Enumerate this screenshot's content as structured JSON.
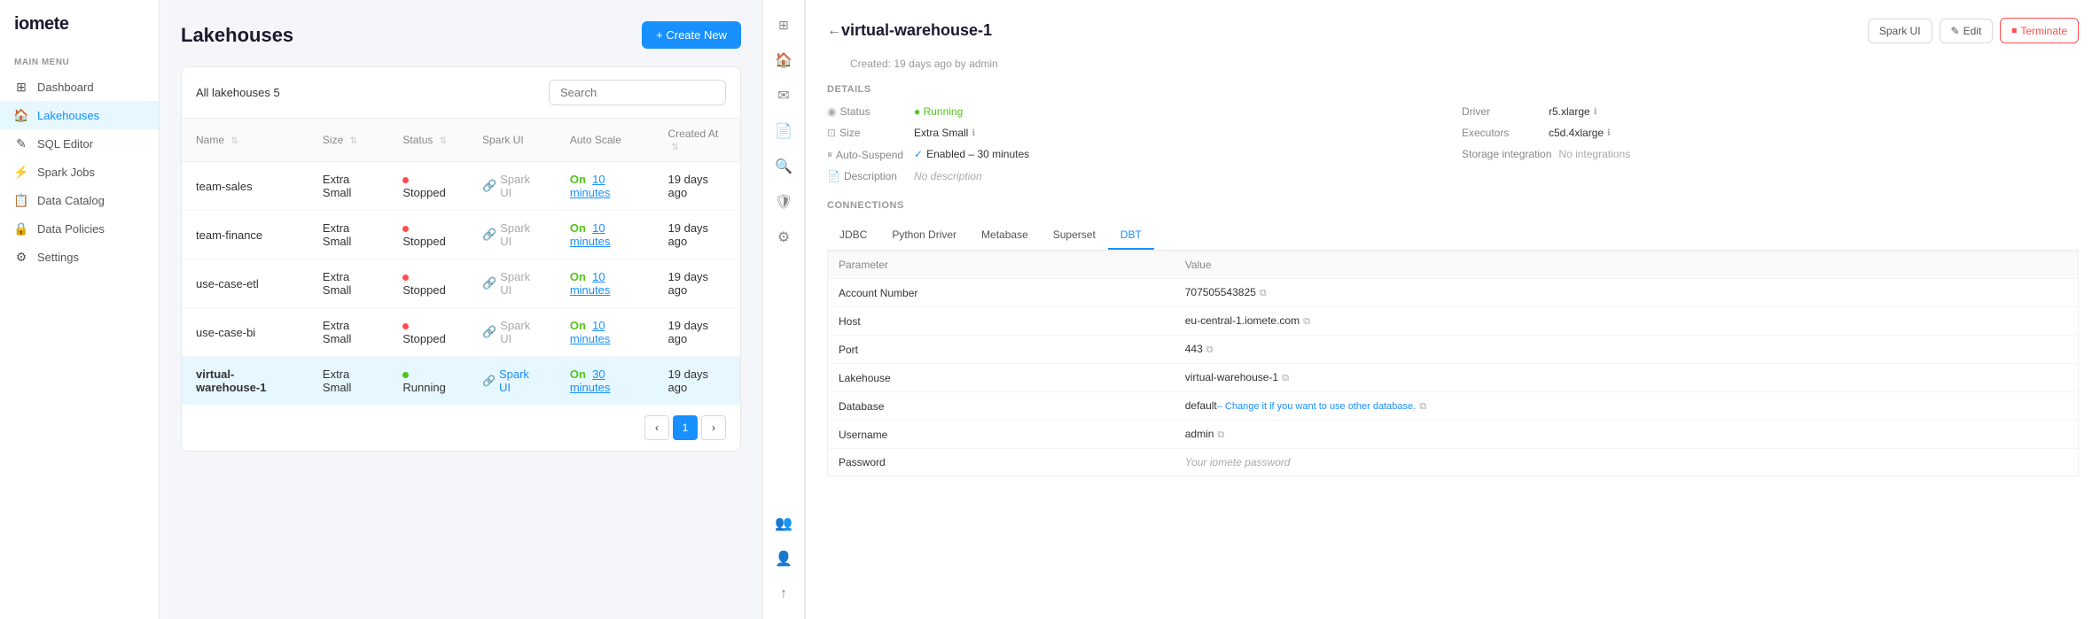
{
  "app": {
    "logo": "iomete",
    "sidebar_toggle_icon": "☰"
  },
  "sidebar": {
    "section_label": "MAIN MENU",
    "items": [
      {
        "id": "dashboard",
        "label": "Dashboard",
        "icon": "⊞",
        "active": false
      },
      {
        "id": "lakehouses",
        "label": "Lakehouses",
        "icon": "🏠",
        "active": true
      },
      {
        "id": "sql-editor",
        "label": "SQL Editor",
        "icon": "✎",
        "active": false
      },
      {
        "id": "spark-jobs",
        "label": "Spark Jobs",
        "icon": "⚡",
        "active": false
      },
      {
        "id": "data-catalog",
        "label": "Data Catalog",
        "icon": "📋",
        "active": false
      },
      {
        "id": "data-policies",
        "label": "Data Policies",
        "icon": "🔒",
        "active": false
      },
      {
        "id": "settings",
        "label": "Settings",
        "icon": "⚙",
        "active": false
      }
    ]
  },
  "lakehouses": {
    "title": "Lakehouses",
    "create_button": "+ Create New",
    "count_label": "All lakehouses",
    "count": "5",
    "search_placeholder": "Search",
    "columns": [
      "Name",
      "Size",
      "Status",
      "Spark UI",
      "Auto Scale",
      "Created At"
    ],
    "rows": [
      {
        "name": "team-sales",
        "size": "Extra Small",
        "status": "Stopped",
        "status_type": "stopped",
        "spark_ui": "Spark UI",
        "spark_ui_enabled": false,
        "autoscale": "On",
        "autoscale_minutes": "10 minutes",
        "created": "19 days ago"
      },
      {
        "name": "team-finance",
        "size": "Extra Small",
        "status": "Stopped",
        "status_type": "stopped",
        "spark_ui": "Spark UI",
        "spark_ui_enabled": false,
        "autoscale": "On",
        "autoscale_minutes": "10 minutes",
        "created": "19 days ago"
      },
      {
        "name": "use-case-etl",
        "size": "Extra Small",
        "status": "Stopped",
        "status_type": "stopped",
        "spark_ui": "Spark UI",
        "spark_ui_enabled": false,
        "autoscale": "On",
        "autoscale_minutes": "10 minutes",
        "created": "19 days ago"
      },
      {
        "name": "use-case-bi",
        "size": "Extra Small",
        "status": "Stopped",
        "status_type": "stopped",
        "spark_ui": "Spark UI",
        "spark_ui_enabled": false,
        "autoscale": "On",
        "autoscale_minutes": "10 minutes",
        "created": "19 days ago"
      },
      {
        "name": "virtual-warehouse-1",
        "size": "Extra Small",
        "status": "Running",
        "status_type": "running",
        "spark_ui": "Spark UI",
        "spark_ui_enabled": true,
        "autoscale": "On",
        "autoscale_minutes": "30 minutes",
        "created": "19 days ago",
        "active": true
      }
    ],
    "pagination": {
      "current": 1,
      "total": 1
    }
  },
  "detail": {
    "back_icon": "←",
    "title": "virtual-warehouse-1",
    "subtitle": "Created: 19 days ago by admin",
    "actions": {
      "spark_ui": "Spark UI",
      "edit": "Edit",
      "terminate": "Terminate"
    },
    "sections": {
      "details_title": "DETAILS",
      "details": {
        "left": [
          {
            "key": "Status",
            "key_icon": "◉",
            "value": "Running",
            "value_type": "running"
          },
          {
            "key": "Size",
            "key_icon": "⊡",
            "value": "Extra Small",
            "has_info": true
          },
          {
            "key": "Auto-Suspend",
            "key_icon": "⏸",
            "value": "Enabled – 30 minutes"
          },
          {
            "key": "Description",
            "key_icon": "📄",
            "value": "No description"
          }
        ],
        "right": [
          {
            "key": "Driver",
            "value": "r5.xlarge",
            "has_info": true
          },
          {
            "key": "Executors",
            "value": "c5d.4xlarge",
            "has_info": true
          },
          {
            "key": "Storage integration",
            "value": "No integrations"
          }
        ]
      },
      "connections_title": "CONNECTIONS",
      "connection_tabs": [
        "JDBC",
        "Python Driver",
        "Metabase",
        "Superset",
        "DBT"
      ],
      "active_tab": "DBT",
      "connection_columns": [
        "Parameter",
        "Value"
      ],
      "connection_rows": [
        {
          "param": "Account Number",
          "value": "707505543825",
          "copyable": true
        },
        {
          "param": "Host",
          "value": "eu-central-1.iomete.com",
          "copyable": true
        },
        {
          "param": "Port",
          "value": "443",
          "copyable": true
        },
        {
          "param": "Lakehouse",
          "value": "virtual-warehouse-1",
          "copyable": true
        },
        {
          "param": "Database",
          "value": "default",
          "extra": "– Change it if you want to use other database.",
          "copyable": true
        },
        {
          "param": "Username",
          "value": "admin",
          "copyable": true
        },
        {
          "param": "Password",
          "value": "Your iomete password",
          "is_placeholder": true
        }
      ]
    }
  },
  "icon_strip": {
    "icons": [
      "🏠",
      "✉",
      "📄",
      "🔍",
      "🛡",
      "⚙",
      "📦",
      "👤",
      "↑"
    ]
  }
}
